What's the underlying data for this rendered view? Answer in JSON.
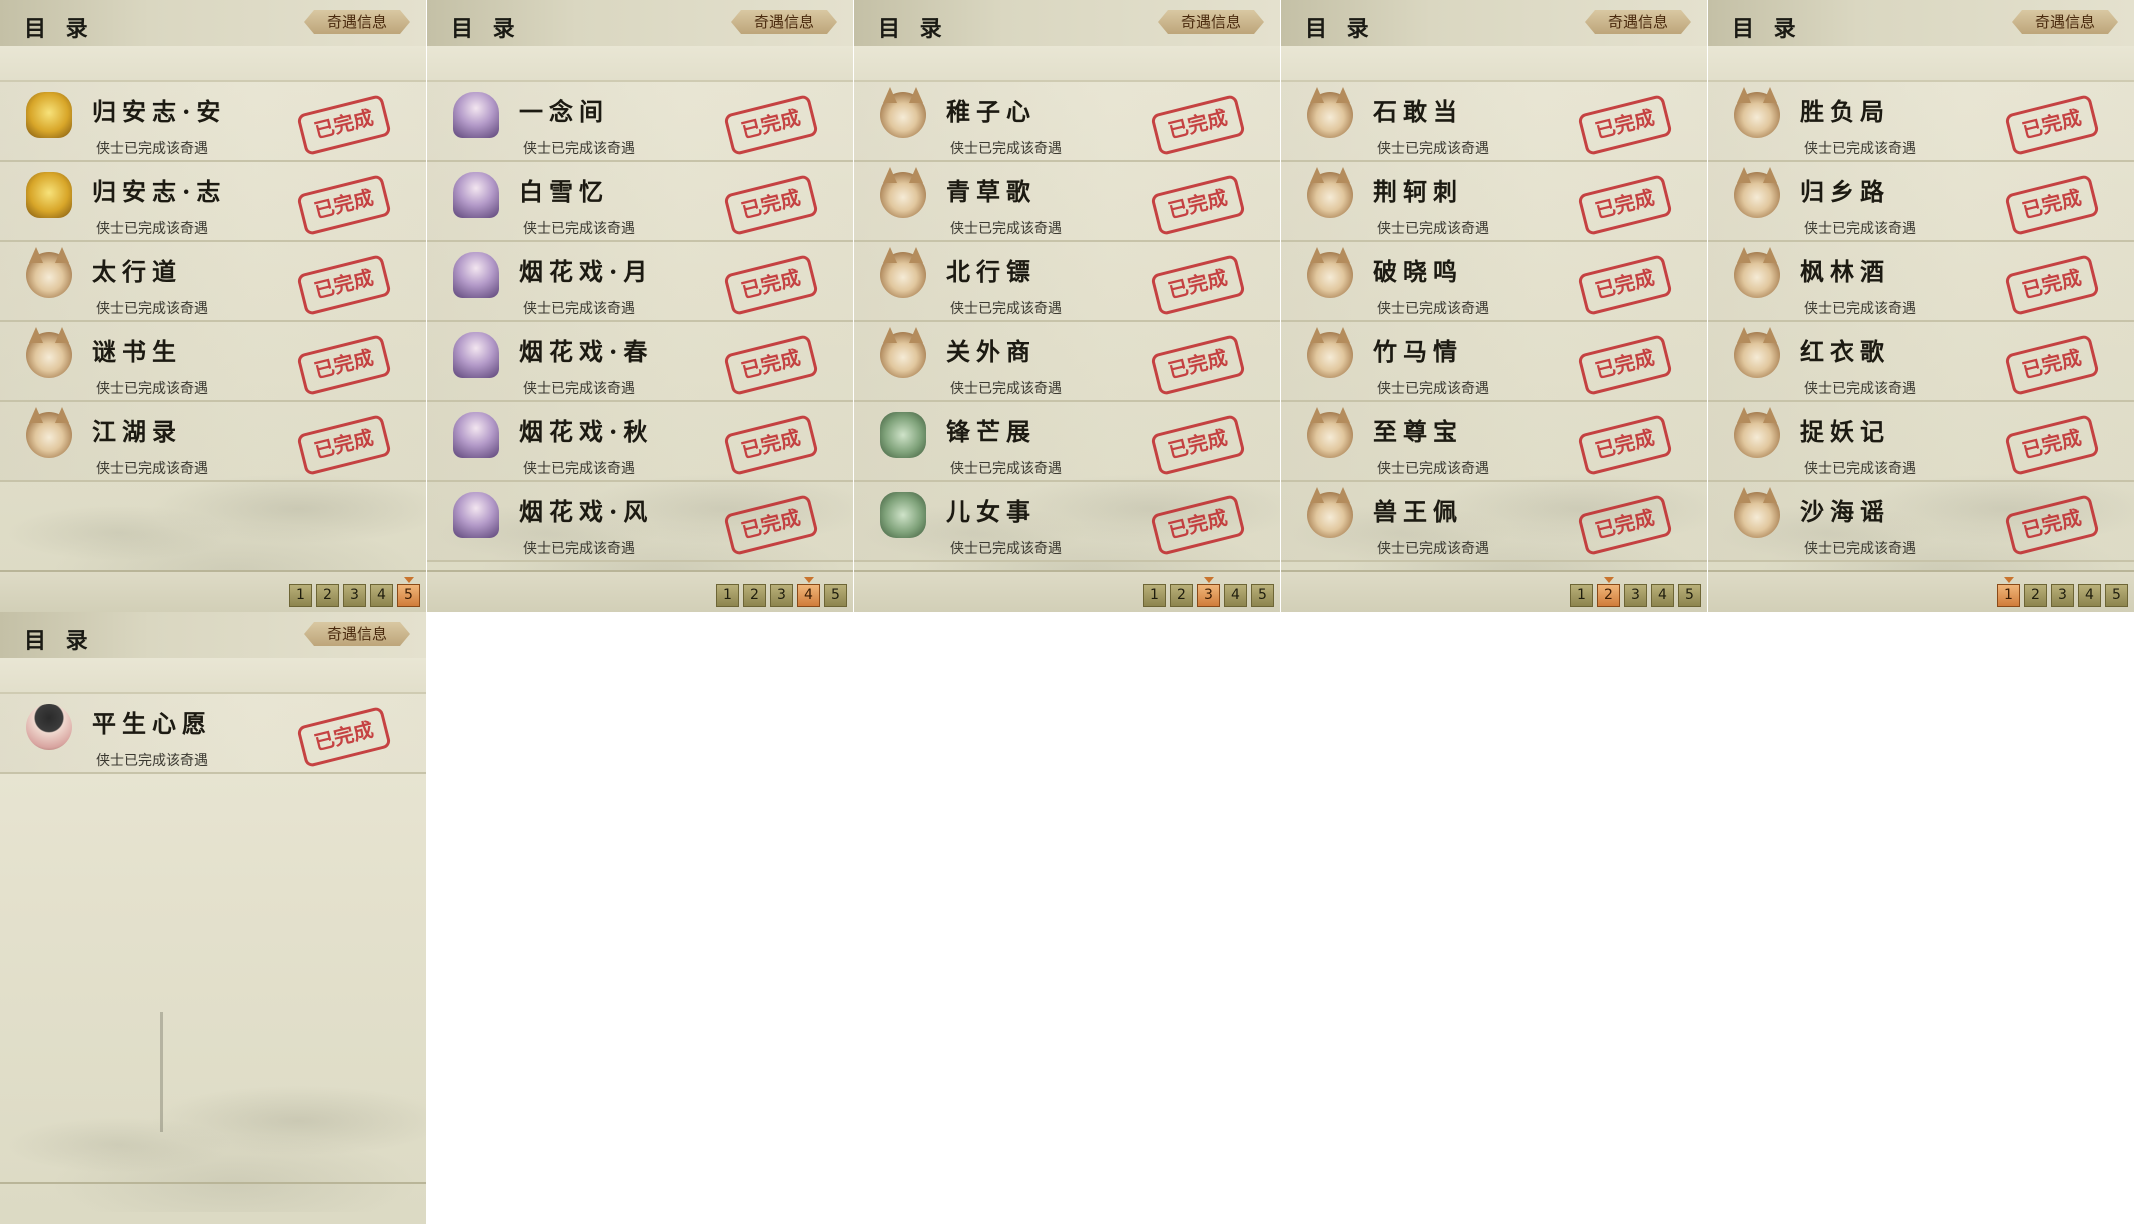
{
  "panels": [
    {
      "title": "目 录",
      "info_button": "奇遇信息",
      "active_page": 5,
      "pages": [
        "1",
        "2",
        "3",
        "4",
        "5"
      ],
      "entries": [
        {
          "name": "归安志·安",
          "sub": "侠士已完成该奇遇",
          "icon": "gold-statue-icon",
          "stamp": "已完成"
        },
        {
          "name": "归安志·志",
          "sub": "侠士已完成该奇遇",
          "icon": "gold-statue-icon",
          "stamp": "已完成"
        },
        {
          "name": "太行道",
          "sub": "侠士已完成该奇遇",
          "icon": "cat-icon",
          "stamp": "已完成"
        },
        {
          "name": "谜书生",
          "sub": "侠士已完成该奇遇",
          "icon": "cat-icon",
          "stamp": "已完成"
        },
        {
          "name": "江湖录",
          "sub": "侠士已完成该奇遇",
          "icon": "cat-icon",
          "stamp": "已完成"
        }
      ]
    },
    {
      "title": "目 录",
      "info_button": "奇遇信息",
      "active_page": 4,
      "pages": [
        "1",
        "2",
        "3",
        "4",
        "5"
      ],
      "entries": [
        {
          "name": "一念间",
          "sub": "侠士已完成该奇遇",
          "icon": "lady-icon",
          "stamp": "已完成"
        },
        {
          "name": "白雪忆",
          "sub": "侠士已完成该奇遇",
          "icon": "lady-icon",
          "stamp": "已完成"
        },
        {
          "name": "烟花戏·月",
          "sub": "侠士已完成该奇遇",
          "icon": "lady-icon",
          "stamp": "已完成"
        },
        {
          "name": "烟花戏·春",
          "sub": "侠士已完成该奇遇",
          "icon": "lady-icon",
          "stamp": "已完成"
        },
        {
          "name": "烟花戏·秋",
          "sub": "侠士已完成该奇遇",
          "icon": "lady-icon",
          "stamp": "已完成"
        },
        {
          "name": "烟花戏·风",
          "sub": "侠士已完成该奇遇",
          "icon": "lady-icon",
          "stamp": "已完成"
        }
      ]
    },
    {
      "title": "目 录",
      "info_button": "奇遇信息",
      "active_page": 3,
      "pages": [
        "1",
        "2",
        "3",
        "4",
        "5"
      ],
      "entries": [
        {
          "name": "稚子心",
          "sub": "侠士已完成该奇遇",
          "icon": "cat-icon",
          "stamp": "已完成"
        },
        {
          "name": "青草歌",
          "sub": "侠士已完成该奇遇",
          "icon": "cat-icon",
          "stamp": "已完成"
        },
        {
          "name": "北行镖",
          "sub": "侠士已完成该奇遇",
          "icon": "cat-icon",
          "stamp": "已完成"
        },
        {
          "name": "关外商",
          "sub": "侠士已完成该奇遇",
          "icon": "cat-icon",
          "stamp": "已完成"
        },
        {
          "name": "锋芒展",
          "sub": "侠士已完成该奇遇",
          "icon": "frog-icon",
          "stamp": "已完成"
        },
        {
          "name": "儿女事",
          "sub": "侠士已完成该奇遇",
          "icon": "frog-icon",
          "stamp": "已完成"
        }
      ]
    },
    {
      "title": "目 录",
      "info_button": "奇遇信息",
      "active_page": 2,
      "pages": [
        "1",
        "2",
        "3",
        "4",
        "5"
      ],
      "entries": [
        {
          "name": "石敢当",
          "sub": "侠士已完成该奇遇",
          "icon": "cat-icon",
          "stamp": "已完成"
        },
        {
          "name": "荆轲刺",
          "sub": "侠士已完成该奇遇",
          "icon": "cat-icon",
          "stamp": "已完成"
        },
        {
          "name": "破晓鸣",
          "sub": "侠士已完成该奇遇",
          "icon": "cat-icon",
          "stamp": "已完成"
        },
        {
          "name": "竹马情",
          "sub": "侠士已完成该奇遇",
          "icon": "cat-icon",
          "stamp": "已完成"
        },
        {
          "name": "至尊宝",
          "sub": "侠士已完成该奇遇",
          "icon": "cat-icon",
          "stamp": "已完成"
        },
        {
          "name": "兽王佩",
          "sub": "侠士已完成该奇遇",
          "icon": "cat-icon",
          "stamp": "已完成"
        }
      ]
    },
    {
      "title": "目 录",
      "info_button": "奇遇信息",
      "active_page": 1,
      "pages": [
        "1",
        "2",
        "3",
        "4",
        "5"
      ],
      "entries": [
        {
          "name": "胜负局",
          "sub": "侠士已完成该奇遇",
          "icon": "cat-icon",
          "stamp": "已完成"
        },
        {
          "name": "归乡路",
          "sub": "侠士已完成该奇遇",
          "icon": "cat-icon",
          "stamp": "已完成"
        },
        {
          "name": "枫林酒",
          "sub": "侠士已完成该奇遇",
          "icon": "cat-icon",
          "stamp": "已完成"
        },
        {
          "name": "红衣歌",
          "sub": "侠士已完成该奇遇",
          "icon": "cat-icon",
          "stamp": "已完成"
        },
        {
          "name": "捉妖记",
          "sub": "侠士已完成该奇遇",
          "icon": "cat-icon",
          "stamp": "已完成"
        },
        {
          "name": "沙海谣",
          "sub": "侠士已完成该奇遇",
          "icon": "cat-icon",
          "stamp": "已完成"
        }
      ]
    },
    {
      "title": "目 录",
      "info_button": "奇遇信息",
      "active_page": null,
      "pages": [],
      "entries": [
        {
          "name": "平生心愿",
          "sub": "侠士已完成该奇遇",
          "icon": "bowl-hat-icon",
          "stamp": "已完成"
        }
      ]
    }
  ]
}
